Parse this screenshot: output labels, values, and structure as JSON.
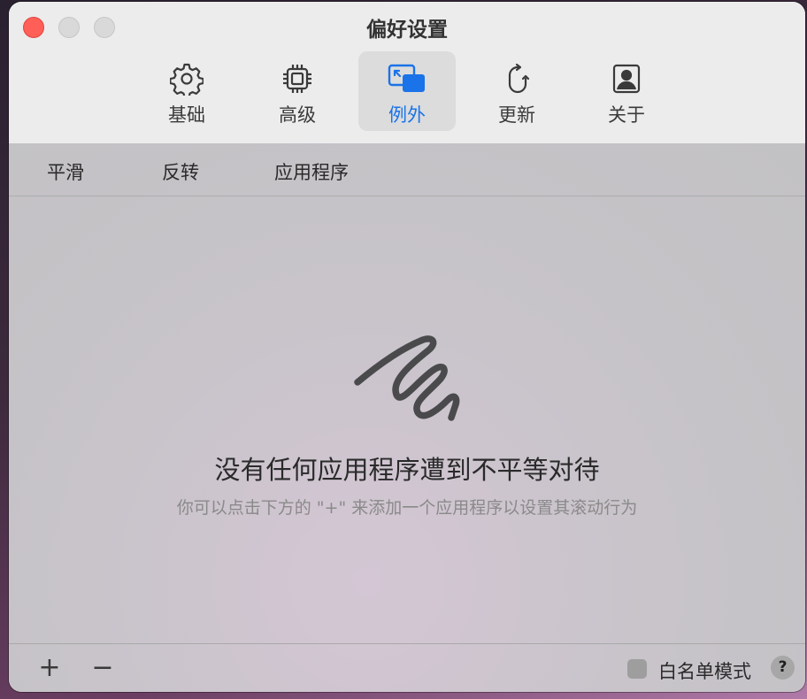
{
  "window": {
    "title": "偏好设置"
  },
  "toolbar": {
    "tabs": [
      {
        "label": "基础",
        "icon": "gear-icon"
      },
      {
        "label": "高级",
        "icon": "cpu-chip-icon"
      },
      {
        "label": "例外",
        "icon": "windows-exception-icon",
        "active": true
      },
      {
        "label": "更新",
        "icon": "refresh-icon"
      },
      {
        "label": "关于",
        "icon": "person-icon"
      }
    ]
  },
  "table": {
    "columns": [
      "平滑",
      "反转",
      "应用程序"
    ]
  },
  "empty_state": {
    "icon": "scribble-icon",
    "title": "没有任何应用程序遭到不平等对待",
    "subtitle": "你可以点击下方的 \"+\" 来添加一个应用程序以设置其滚动行为"
  },
  "bottom_bar": {
    "add_symbol": "+",
    "remove_symbol": "−",
    "whitelist_label": "白名单模式",
    "help_symbol": "?"
  },
  "colors": {
    "accent": "#1a73e8",
    "close_button": "#ff5f57"
  }
}
